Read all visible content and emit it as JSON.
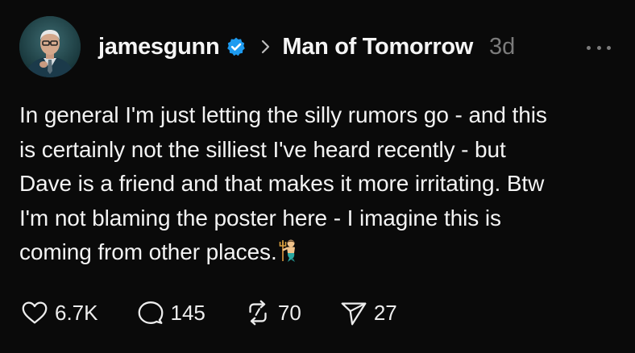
{
  "post": {
    "author": {
      "username": "jamesgunn",
      "verified_icon": "verified-badge-icon",
      "avatar": "avatar"
    },
    "separator_icon": "chevron-right-icon",
    "topic": "Man of Tomorrow",
    "time": "3d",
    "more_icon": "more-icon",
    "text_lines": [
      "In general I'm just letting the silly rumors go - and this",
      "is certainly not the silliest I've heard recently - but",
      "Dave is a friend and that makes it more irritating. Btw",
      "I'm not blaming the poster here - I imagine this is",
      "coming from other places."
    ],
    "emoji": "merman-emoji-icon",
    "actions": {
      "like": {
        "icon": "heart-icon",
        "count": "6.7K"
      },
      "reply": {
        "icon": "comment-icon",
        "count": "145"
      },
      "repost": {
        "icon": "repost-icon",
        "count": "70"
      },
      "share": {
        "icon": "send-icon",
        "count": "27"
      }
    },
    "colors": {
      "background": "#0a0a0a",
      "text": "#f3f3f3",
      "muted": "#7b7b7b",
      "verified": "#1d9bf0"
    }
  }
}
